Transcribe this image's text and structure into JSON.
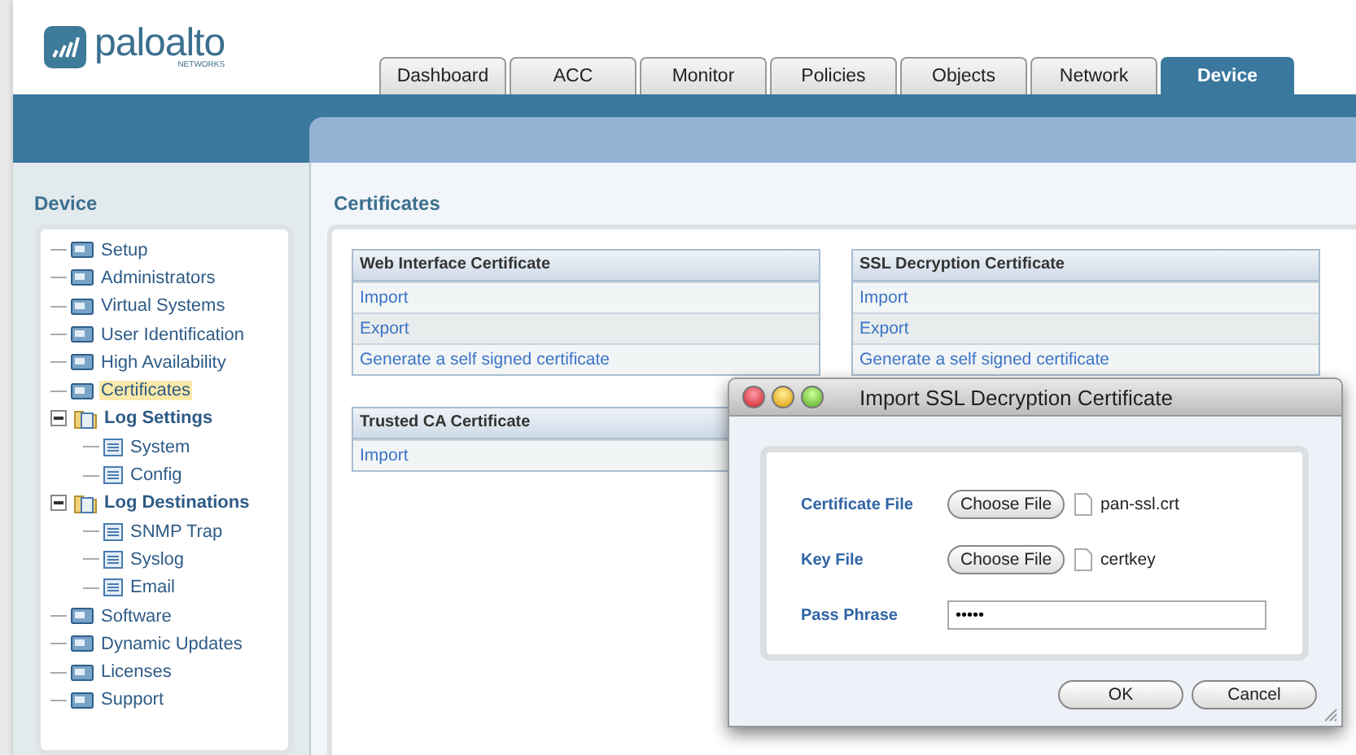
{
  "logo": {
    "name": "paloalto",
    "subtitle": "NETWORKS"
  },
  "tabs": [
    {
      "label": "Dashboard",
      "selected": false
    },
    {
      "label": "ACC",
      "selected": false
    },
    {
      "label": "Monitor",
      "selected": false
    },
    {
      "label": "Policies",
      "selected": false
    },
    {
      "label": "Objects",
      "selected": false
    },
    {
      "label": "Network",
      "selected": false
    },
    {
      "label": "Device",
      "selected": true
    }
  ],
  "sidebar": {
    "title": "Device",
    "items": [
      {
        "label": "Setup",
        "selected": false
      },
      {
        "label": "Administrators",
        "selected": false
      },
      {
        "label": "Virtual Systems",
        "selected": false
      },
      {
        "label": "User Identification",
        "selected": false
      },
      {
        "label": "High Availability",
        "selected": false
      },
      {
        "label": "Certificates",
        "selected": true
      },
      {
        "label": "Log Settings",
        "selected": false,
        "expanded": true,
        "children": [
          {
            "label": "System",
            "selected": false
          },
          {
            "label": "Config",
            "selected": false
          }
        ]
      },
      {
        "label": "Log Destinations",
        "selected": false,
        "expanded": true,
        "children": [
          {
            "label": "SNMP Trap",
            "selected": false
          },
          {
            "label": "Syslog",
            "selected": false
          },
          {
            "label": "Email",
            "selected": false
          }
        ]
      },
      {
        "label": "Software",
        "selected": false
      },
      {
        "label": "Dynamic Updates",
        "selected": false
      },
      {
        "label": "Licenses",
        "selected": false
      },
      {
        "label": "Support",
        "selected": false
      }
    ]
  },
  "main": {
    "title": "Certificates",
    "tables": [
      {
        "heading": "Web Interface Certificate",
        "links": [
          "Import",
          "Export",
          "Generate a self signed certificate"
        ]
      },
      {
        "heading": "SSL Decryption Certificate",
        "links": [
          "Import",
          "Export",
          "Generate a self signed certificate"
        ]
      },
      {
        "heading": "Trusted CA Certificate",
        "links": [
          "Import"
        ]
      }
    ]
  },
  "dialog": {
    "title": "Import SSL Decryption Certificate",
    "fields": [
      {
        "kind": "file",
        "label": "Certificate File",
        "button": "Choose File",
        "value": "pan-ssl.crt"
      },
      {
        "kind": "file",
        "label": "Key File",
        "button": "Choose File",
        "value": "certkey"
      },
      {
        "kind": "password",
        "label": "Pass Phrase",
        "value": "•••••"
      }
    ],
    "buttons": [
      "OK",
      "Cancel"
    ]
  }
}
